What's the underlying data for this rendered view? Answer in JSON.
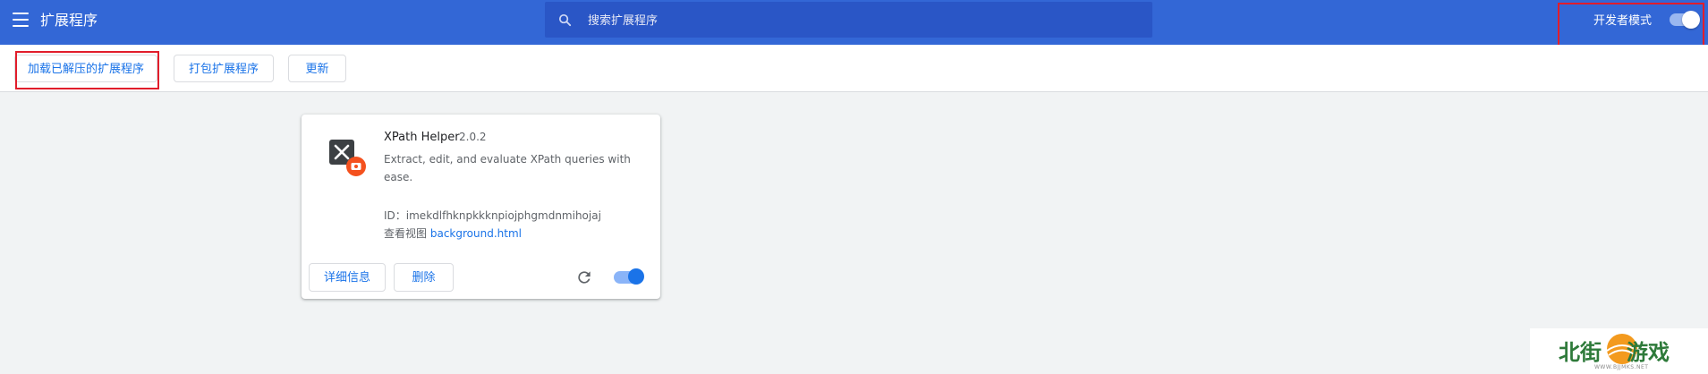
{
  "header": {
    "title": "扩展程序",
    "search_placeholder": "搜索扩展程序",
    "dev_mode_label": "开发者模式",
    "dev_mode_on": true
  },
  "toolbar": {
    "load_unpacked": "加载已解压的扩展程序",
    "pack": "打包扩展程序",
    "update": "更新"
  },
  "extension": {
    "name": "XPath Helper",
    "version": "2.0.2",
    "description": "Extract, edit, and evaluate XPath queries with ease.",
    "id_label": "ID：",
    "id_value": "imekdlfhknpkkknpiojphgmdnmihojaj",
    "views_label": "查看视图",
    "views_link": "background.html",
    "details_button": "详细信息",
    "remove_button": "删除",
    "enabled": true
  },
  "watermark": {
    "left": "北街",
    "right": "游戏",
    "sub": "WWW.BJJMKS.NET"
  },
  "colors": {
    "header": "#3367d6",
    "search_bg": "#2a56c6",
    "accent": "#1a73e8",
    "highlight": "#e11d2b",
    "background": "#f1f3f4"
  },
  "icons": [
    "menu-icon",
    "search-icon",
    "reload-icon",
    "extension-icon"
  ]
}
